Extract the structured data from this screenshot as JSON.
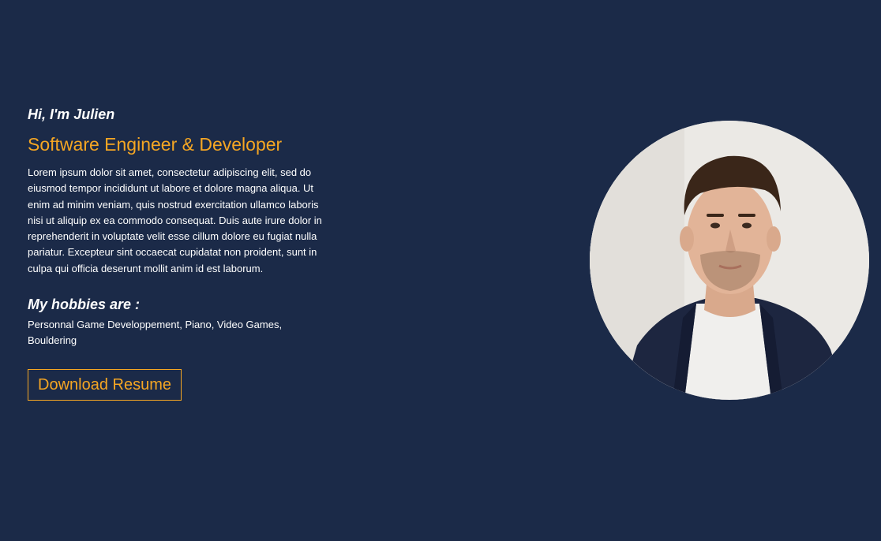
{
  "hero": {
    "greeting": "Hi, I'm Julien",
    "role": "Software Engineer & Developer",
    "bio": "Lorem ipsum dolor sit amet, consectetur adipiscing elit, sed do eiusmod tempor incididunt ut labore et dolore magna aliqua. Ut enim ad minim veniam, quis nostrud exercitation ullamco laboris nisi ut aliquip ex ea commodo consequat. Duis aute irure dolor in reprehenderit in voluptate velit esse cillum dolore eu fugiat nulla pariatur. Excepteur sint occaecat cupidatat non proident, sunt in culpa qui officia deserunt mollit anim id est laborum.",
    "hobbies_title": "My hobbies are :",
    "hobbies_text": "Personnal Game Developpement, Piano, Video Games, Bouldering",
    "download_label": "Download Resume"
  },
  "colors": {
    "background": "#1b2a48",
    "accent": "#f5a623",
    "text": "#ffffff"
  }
}
